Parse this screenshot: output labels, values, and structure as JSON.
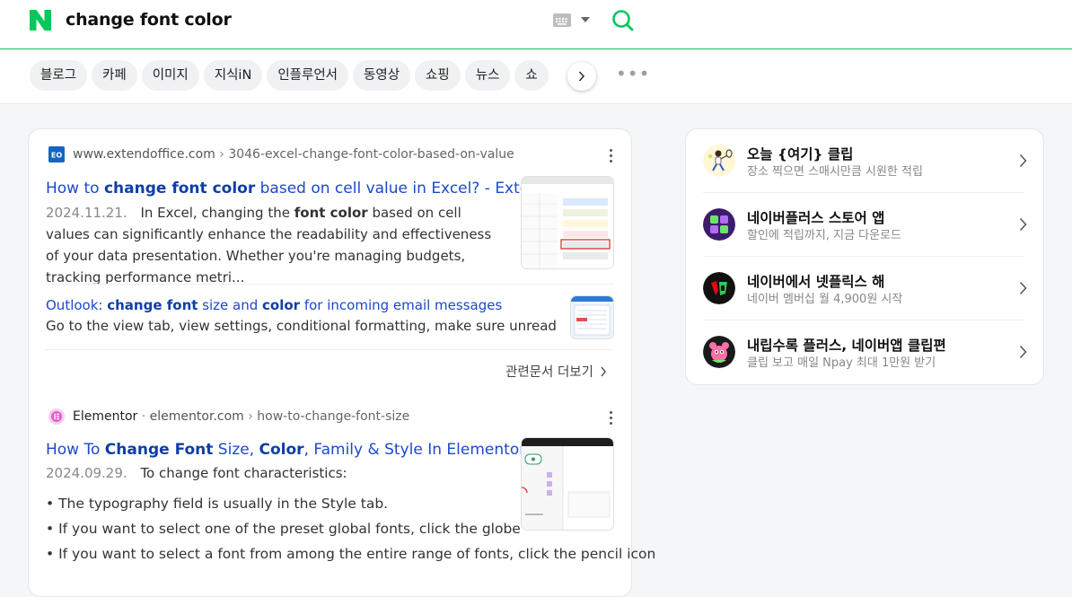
{
  "header": {
    "query": "change font color",
    "colors": {
      "brand": "#03c75a",
      "underline": "#1fbd5a"
    }
  },
  "tabs": [
    "블로그",
    "카페",
    "이미지",
    "지식iN",
    "인플루언서",
    "동영상",
    "쇼핑",
    "뉴스",
    "쇼"
  ],
  "results": [
    {
      "source_site": "www.extendoffice.com",
      "source_path": "3046-excel-change-font-color-based-on-value",
      "title_pre": "How to ",
      "title_bold": "change font color",
      "title_post": " based on cell value in Excel? - Exte...",
      "date": "2024.11.21.",
      "desc_pre": "In Excel, changing the ",
      "desc_bold": "font color",
      "desc_post": " based on cell values can significantly enhance the readability and effectiveness of your data presentation. Whether you're managing budgets, tracking performance metri...",
      "sub": {
        "t1": "Outlook: ",
        "t2": "change font",
        "t3": " size and ",
        "t4": "color",
        "t5": " for incoming email messages",
        "desc": "Go to the view tab, view settings, conditional formatting, make sure unread message..."
      },
      "more": "관련문서 더보기"
    },
    {
      "source_name": "Elementor",
      "source_site": "elementor.com",
      "source_path": "how-to-change-font-size",
      "title_pre": "How To ",
      "title_b1": "Change Font",
      "title_mid": " Size, ",
      "title_b2": "Color",
      "title_post": ", Family & Style In Elementor",
      "date": "2024.09.29.",
      "desc": "To change font characteristics:",
      "bullets": [
        "The typography field is usually in the Style tab.",
        "If you want to select one of the preset global fonts, click the globe",
        "If you want to select a font from among the entire range of fonts, click the pencil icon"
      ]
    }
  ],
  "side": [
    {
      "title": "오늘 {여기} 클립",
      "sub": "장소 찍으면 스매시만큼 시원한 적립",
      "icon": "tennis-player-icon"
    },
    {
      "title": "네이버플러스 스토어 앱",
      "sub": "할인에 적립까지, 지금 다운로드",
      "icon": "store-app-icon"
    },
    {
      "title": "네이버에서 넷플릭스 해",
      "sub": "네이버 멤버십 월 4,900원 시작",
      "icon": "netflix-badge-icon"
    },
    {
      "title": "내립수록 플러스, 네이버앱 클립편",
      "sub": "클립 보고 매일 Npay 최대 1만원 받기",
      "icon": "clip-character-icon"
    }
  ]
}
